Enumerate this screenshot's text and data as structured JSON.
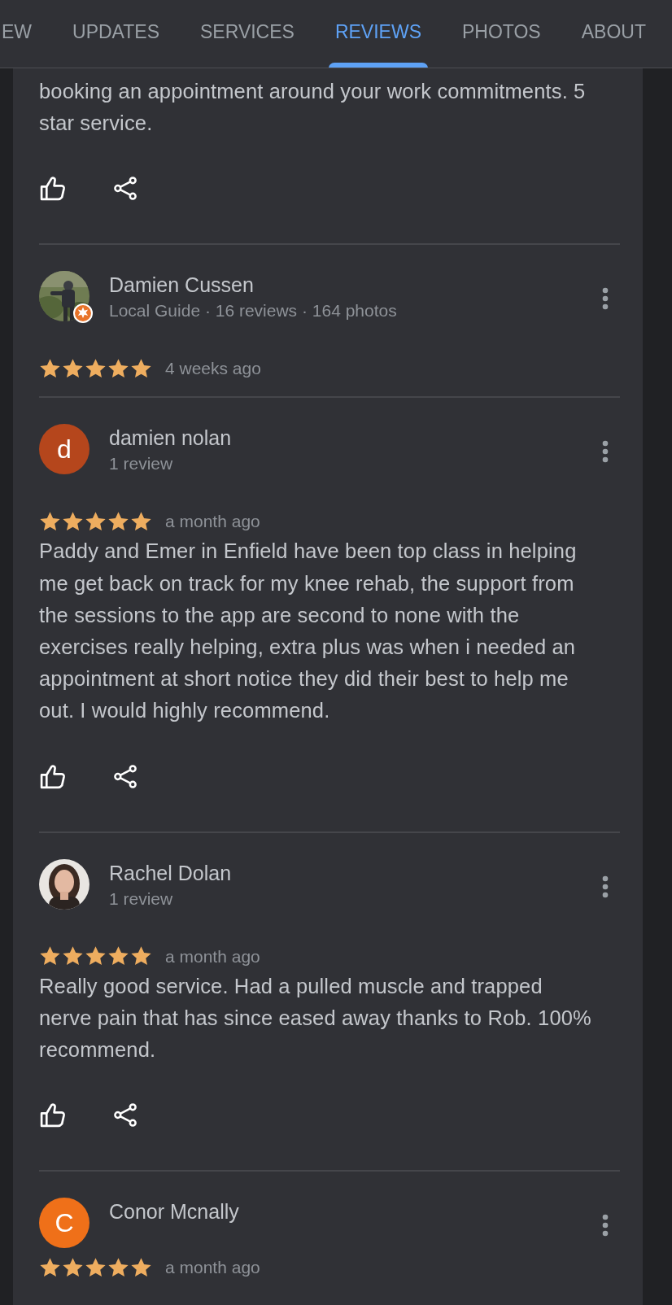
{
  "tabs": [
    {
      "label": "EW",
      "selected": false
    },
    {
      "label": "UPDATES",
      "selected": false
    },
    {
      "label": "SERVICES",
      "selected": false
    },
    {
      "label": "REVIEWS",
      "selected": true
    },
    {
      "label": "PHOTOS",
      "selected": false
    },
    {
      "label": "ABOUT",
      "selected": false
    }
  ],
  "reviews": [
    {
      "text": "booking an appointment around your work commitments. 5 star service."
    },
    {
      "author": "Damien Cussen",
      "local_guide": true,
      "meta": "Local Guide · 16 reviews · 164 photos",
      "stars": 5,
      "time": "4 weeks ago"
    },
    {
      "author": "damien nolan",
      "avatar": {
        "kind": "letter",
        "letter": "d",
        "color": "#b5461c"
      },
      "meta": "1 review",
      "stars": 5,
      "time": "a month ago",
      "text": "Paddy and Emer in Enfield have been top class in helping me get back on track for my knee rehab, the support from the sessions to the app are second to none with the exercises really helping, extra plus was when i needed an appointment at short notice they did their best to help me out. I would highly recommend."
    },
    {
      "author": "Rachel Dolan",
      "meta": "1 review",
      "stars": 5,
      "time": "a month ago",
      "text": "Really good service. Had a pulled muscle and trapped nerve pain that has since eased away thanks to Rob. 100% recommend."
    },
    {
      "author": "Conor Mcnally",
      "avatar": {
        "kind": "letter",
        "letter": "C",
        "color": "#ef7019"
      },
      "stars": 5,
      "time": "a month ago"
    }
  ]
}
